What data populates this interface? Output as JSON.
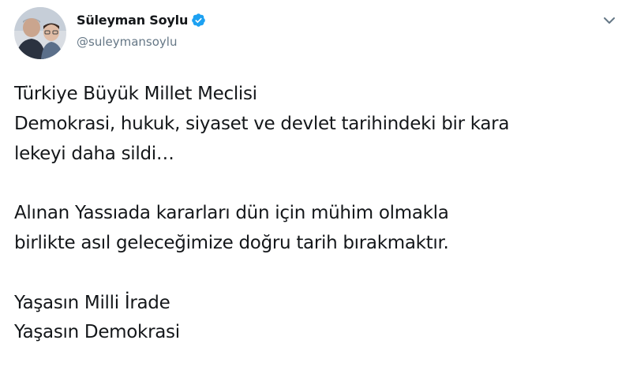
{
  "author": {
    "display_name": "Süleyman Soylu",
    "handle": "@suleymansoylu",
    "verified": true,
    "verified_icon": "verified-badge-icon",
    "verified_color": "#1da1f2"
  },
  "menu": {
    "icon": "chevron-down-icon"
  },
  "tweet": {
    "paragraphs": [
      {
        "lines": [
          "Türkiye Büyük Millet Meclisi",
          "Demokrasi, hukuk, siyaset ve devlet tarihindeki bir kara",
          "lekeyi daha sildi…"
        ]
      },
      {
        "lines": [
          "Alınan Yassıada kararları dün için mühim olmakla",
          "birlikte asıl geleceğimize doğru tarih bırakmaktır."
        ]
      },
      {
        "lines": [
          "Yaşasın Milli İrade",
          "Yaşasın Demokrasi"
        ]
      }
    ]
  },
  "colors": {
    "text": "#14171a",
    "secondary": "#657786",
    "background": "#ffffff"
  }
}
